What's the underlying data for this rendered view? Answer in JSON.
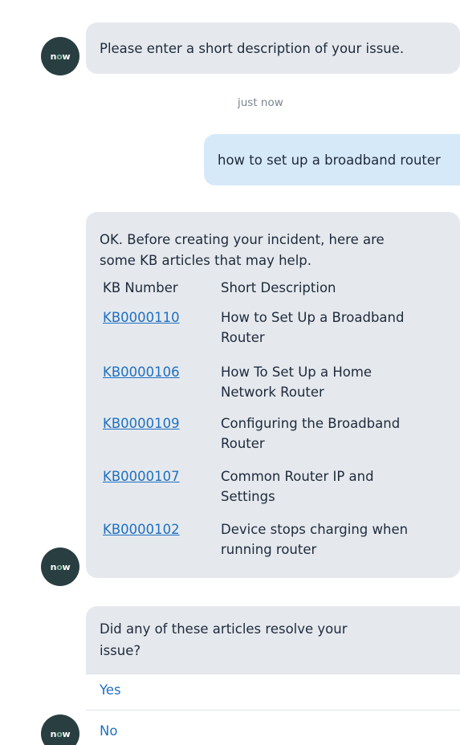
{
  "avatar": {
    "brand_prefix": "n",
    "brand_o": "o",
    "brand_suffix": "w"
  },
  "messages": {
    "prompt": "Please enter a short description of your issue.",
    "timestamp": "just now",
    "user_message": "how to set up a broadband router",
    "kb_intro_line1": "OK. Before creating your incident, here are",
    "kb_intro_line2": "some KB articles that may help.",
    "kb_table": {
      "headers": [
        "KB Number",
        "Short Description"
      ],
      "rows": [
        {
          "number": "KB0000110",
          "desc_line1": "How to Set Up a Broadband",
          "desc_line2": "Router"
        },
        {
          "number": "KB0000106",
          "desc_line1": "How To Set Up a Home",
          "desc_line2": "Network Router"
        },
        {
          "number": "KB0000109",
          "desc_line1": "Configuring the Broadband",
          "desc_line2": "Router"
        },
        {
          "number": "KB0000107",
          "desc_line1": "Common Router IP and",
          "desc_line2": "Settings"
        },
        {
          "number": "KB0000102",
          "desc_line1": "Device stops charging when",
          "desc_line2": "running router"
        }
      ]
    },
    "question_line1": "Did any of these articles resolve your",
    "question_line2": "issue?",
    "options": {
      "yes": "Yes",
      "no": "No"
    }
  },
  "colors": {
    "bot_bubble": "#e5e9ee",
    "user_bubble": "#d6e9f8",
    "link": "#1f70c1",
    "avatar_bg": "#293e40",
    "avatar_accent": "#81b5a1"
  }
}
